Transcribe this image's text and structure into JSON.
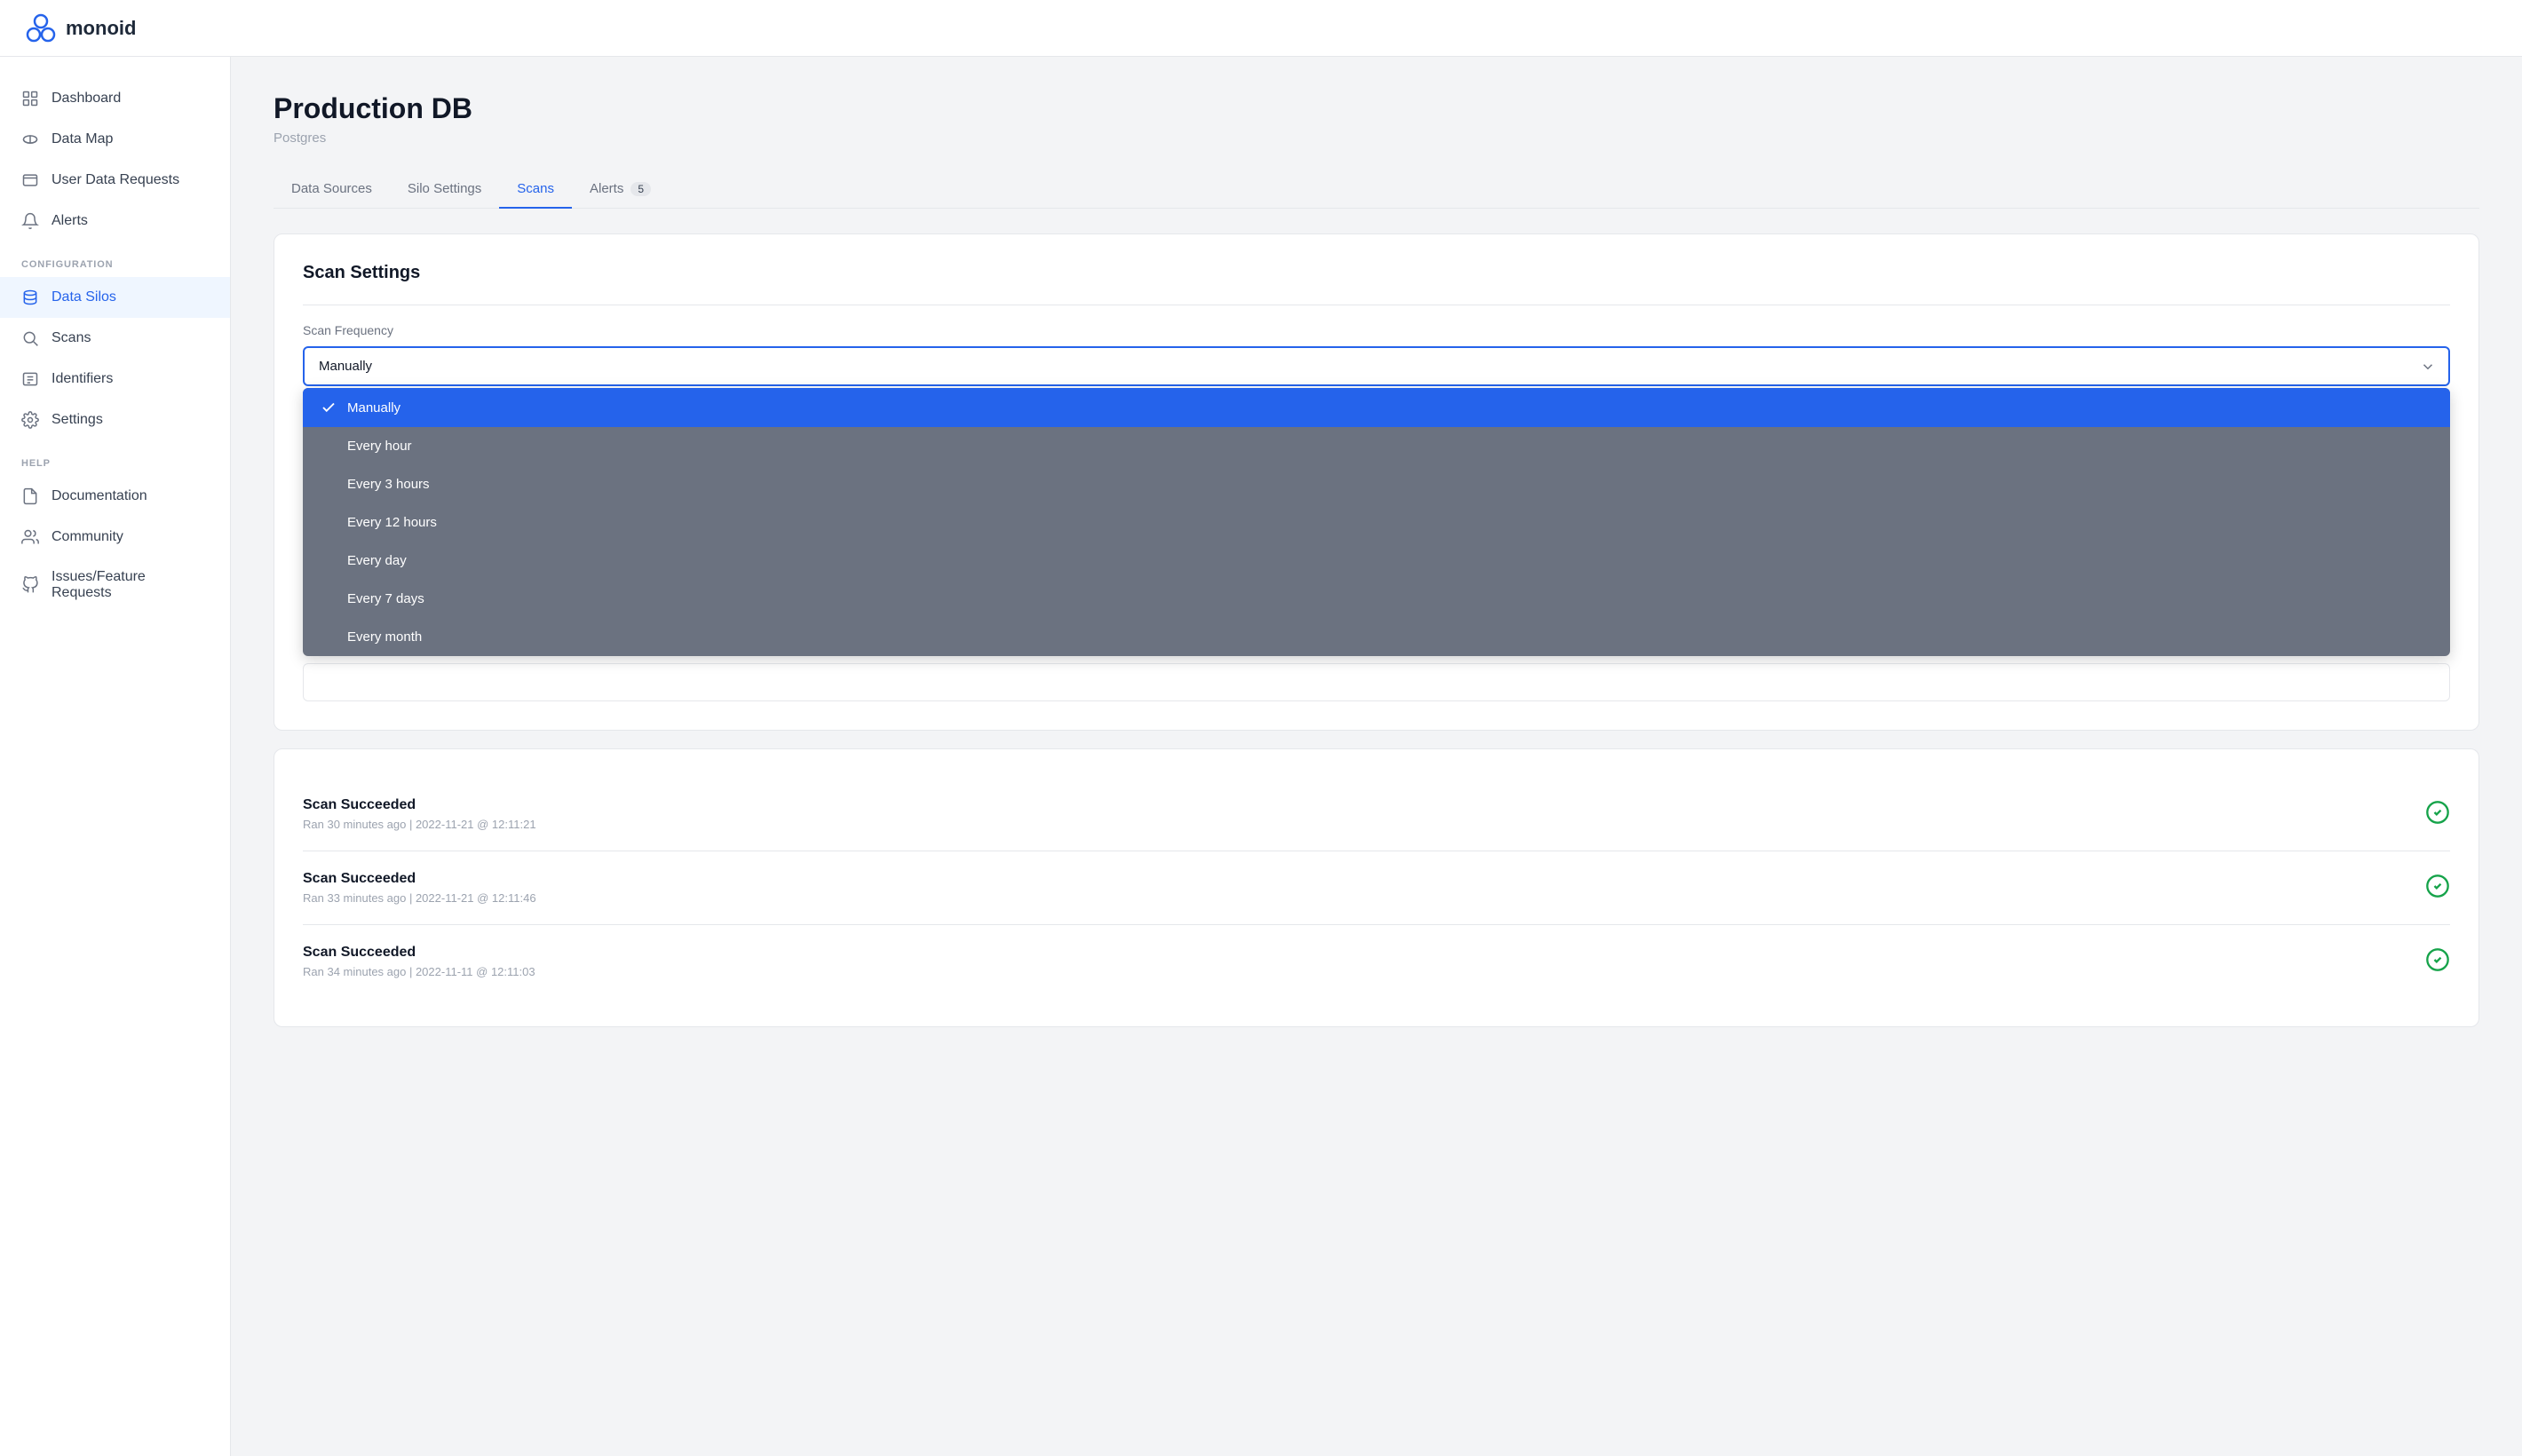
{
  "header": {
    "logo_text": "monoid"
  },
  "sidebar": {
    "nav_items": [
      {
        "id": "dashboard",
        "label": "Dashboard",
        "icon": "dashboard-icon"
      },
      {
        "id": "data-map",
        "label": "Data Map",
        "icon": "data-map-icon"
      },
      {
        "id": "user-data-requests",
        "label": "User Data Requests",
        "icon": "user-requests-icon"
      },
      {
        "id": "alerts",
        "label": "Alerts",
        "icon": "alerts-icon"
      }
    ],
    "config_label": "CONFIGURATION",
    "config_items": [
      {
        "id": "data-silos",
        "label": "Data Silos",
        "icon": "data-silos-icon",
        "active": true
      },
      {
        "id": "scans",
        "label": "Scans",
        "icon": "scans-icon"
      },
      {
        "id": "identifiers",
        "label": "Identifiers",
        "icon": "identifiers-icon"
      },
      {
        "id": "settings",
        "label": "Settings",
        "icon": "settings-icon"
      }
    ],
    "help_label": "HELP",
    "help_items": [
      {
        "id": "documentation",
        "label": "Documentation",
        "icon": "docs-icon"
      },
      {
        "id": "community",
        "label": "Community",
        "icon": "community-icon"
      },
      {
        "id": "issues",
        "label": "Issues/Feature Requests",
        "icon": "github-icon"
      }
    ]
  },
  "page": {
    "title": "Production DB",
    "subtitle": "Postgres",
    "tabs": [
      {
        "id": "data-sources",
        "label": "Data Sources",
        "active": false
      },
      {
        "id": "silo-settings",
        "label": "Silo Settings",
        "active": false
      },
      {
        "id": "scans",
        "label": "Scans",
        "active": true
      },
      {
        "id": "alerts",
        "label": "Alerts",
        "active": false,
        "badge": "5"
      }
    ]
  },
  "scan_settings": {
    "title": "Scan Settings",
    "frequency_label": "Scan Frequency",
    "selected_value": "Manually",
    "dropdown_options": [
      {
        "id": "manually",
        "label": "Manually",
        "selected": true
      },
      {
        "id": "every-hour",
        "label": "Every hour",
        "selected": false
      },
      {
        "id": "every-3-hours",
        "label": "Every 3 hours",
        "selected": false
      },
      {
        "id": "every-12-hours",
        "label": "Every 12 hours",
        "selected": false
      },
      {
        "id": "every-day",
        "label": "Every day",
        "selected": false
      },
      {
        "id": "every-7-days",
        "label": "Every 7 days",
        "selected": false
      },
      {
        "id": "every-month",
        "label": "Every month",
        "selected": false
      }
    ]
  },
  "scan_results": [
    {
      "id": "scan-1",
      "title": "Scan Succeeded",
      "subtitle": "Ran 30 minutes ago | 2022-11-21 @ 12:11:21",
      "status": "success"
    },
    {
      "id": "scan-2",
      "title": "Scan Succeeded",
      "subtitle": "Ran 33 minutes ago | 2022-11-21 @ 12:11:46",
      "status": "success"
    },
    {
      "id": "scan-3",
      "title": "Scan Succeeded",
      "subtitle": "Ran 34 minutes ago | 2022-11-11 @ 12:11:03",
      "status": "success"
    }
  ]
}
